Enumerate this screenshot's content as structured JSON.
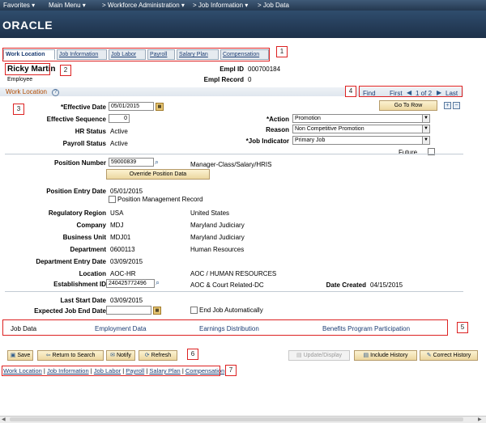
{
  "nav": {
    "favorites": "Favorites ▾",
    "main_menu": "Main Menu ▾",
    "crumb1": "> Workforce Administration ▾",
    "crumb2": "> Job Information ▾",
    "crumb3": "> Job Data"
  },
  "brand": "ORACLE",
  "tabs": [
    "Work Location",
    "Job Information",
    "Job Labor",
    "Payroll",
    "Salary Plan",
    "Compensation"
  ],
  "header": {
    "name": "Ricky Martin",
    "type": "Employee",
    "empl_id_label": "Empl ID",
    "empl_id": "000700184",
    "empl_record_label": "Empl Record",
    "empl_record": "0"
  },
  "section": {
    "title": "Work Location",
    "find": "Find",
    "first": "First",
    "page_of": "1 of 2",
    "last": "Last",
    "go_to_row": "Go To Row"
  },
  "fields": {
    "effective_date_label": "*Effective Date",
    "effective_date": "05/01/2015",
    "effective_seq_label": "Effective Sequence",
    "effective_seq": "0",
    "hr_status_label": "HR Status",
    "hr_status": "Active",
    "payroll_status_label": "Payroll Status",
    "payroll_status": "Active",
    "action_label": "*Action",
    "action": "Promotion",
    "reason_label": "Reason",
    "reason": "Non Competitive Promotion",
    "job_indicator_label": "*Job Indicator",
    "job_indicator": "Primary Job",
    "future": "Future",
    "position_number_label": "Position Number",
    "position_number": "59000839",
    "position_desc": "Manager-Class/Salary/HRIS",
    "override_button": "Override Position Data",
    "position_entry_date_label": "Position Entry Date",
    "position_entry_date": "05/01/2015",
    "position_mgmt_record": "Position Management Record",
    "regulatory_region_label": "Regulatory Region",
    "regulatory_region": "USA",
    "regulatory_region_desc": "United States",
    "company_label": "Company",
    "company": "MDJ",
    "company_desc": "Maryland Judiciary",
    "business_unit_label": "Business Unit",
    "business_unit": "MDJ01",
    "business_unit_desc": "Maryland Judiciary",
    "department_label": "Department",
    "department": "0600113",
    "department_desc": "Human Resources",
    "dept_entry_date_label": "Department Entry Date",
    "dept_entry_date": "03/09/2015",
    "location_label": "Location",
    "location": "AOC-HR",
    "location_desc": "AOC / HUMAN RESOURCES",
    "establishment_id_label": "Establishment ID",
    "establishment_id": "240425772496",
    "establishment_desc": "AOC & Court Related-DC",
    "date_created_label": "Date Created",
    "date_created": "04/15/2015",
    "last_start_date_label": "Last Start Date",
    "last_start_date": "03/09/2015",
    "expected_end_label": "Expected Job End Date",
    "end_job_auto": "End Job Automatically"
  },
  "links": {
    "job_data": "Job Data",
    "employment_data": "Employment Data",
    "earnings_distribution": "Earnings Distribution",
    "benefits": "Benefits Program Participation"
  },
  "toolbar": {
    "save": "Save",
    "return_to_search": "Return to Search",
    "notify": "Notify",
    "refresh": "Refresh",
    "update_display": "Update/Display",
    "include_history": "Include History",
    "correct_history": "Correct History"
  },
  "footer_links": [
    "Work Location",
    "Job Information",
    "Job Labor",
    "Payroll",
    "Salary Plan",
    "Compensation"
  ],
  "footer_sep": "|",
  "callouts": [
    "1",
    "2",
    "3",
    "4",
    "5",
    "6",
    "7"
  ]
}
